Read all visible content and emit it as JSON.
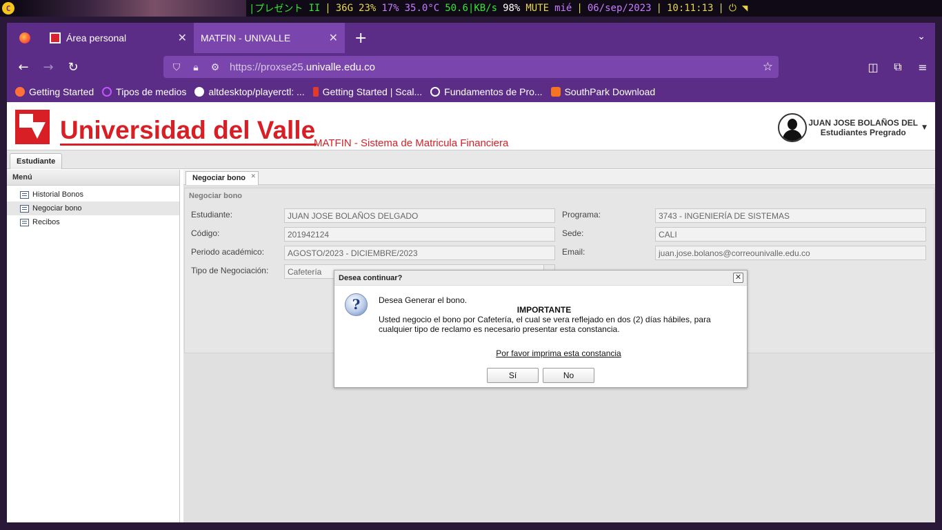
{
  "statusbar": {
    "segments": [
      "|プレゼント",
      "II",
      "|",
      "36G",
      "23%",
      "17%",
      "35.0°C",
      "50.6|KB/s",
      "98%",
      "MUTE",
      "mié",
      "|",
      "06/sep/2023",
      "|",
      "10:11:13",
      "|"
    ]
  },
  "browser": {
    "tabs": [
      {
        "label": "Área personal"
      },
      {
        "label": "MATFIN - UNIVALLE"
      }
    ],
    "url_proto": "https://proxse25.",
    "url_domain": "univalle.edu.co",
    "bookmarks": [
      {
        "label": "Getting Started",
        "color": "#ff7139"
      },
      {
        "label": "Tipos de medios",
        "color": "#c255ff"
      },
      {
        "label": "altdesktop/playerctl: ...",
        "color": "#ffffff"
      },
      {
        "label": "Getting Started | Scal...",
        "color": "#e23b2e"
      },
      {
        "label": "Fundamentos de Pro...",
        "color": "#ffffff"
      },
      {
        "label": "SouthPark Download",
        "color": "#f47421"
      }
    ]
  },
  "header": {
    "title": "Universidad del Valle",
    "subtitle": "MATFIN - Sistema de Matricula Financiera",
    "user_name": "JUAN JOSE BOLAÑOS DEL",
    "user_role": "Estudiantes Pregrado"
  },
  "top_tab": "Estudiante",
  "menu": {
    "title": "Menú",
    "items": [
      "Historial Bonos",
      "Negociar bono",
      "Recibos"
    ]
  },
  "content": {
    "tab": "Negociar bono",
    "panel_title": "Negociar bono",
    "fields": {
      "estudiante_label": "Estudiante:",
      "estudiante": "JUAN JOSE BOLAÑOS DELGADO",
      "codigo_label": "Código:",
      "codigo": "201942124",
      "periodo_label": "Periodo académico:",
      "periodo": "AGOSTO/2023 - DICIEMBRE/2023",
      "tipo_label": "Tipo de Negociación:",
      "tipo": "Cafetería",
      "programa_label": "Programa:",
      "programa": "3743 - INGENIERÍA DE SISTEMAS",
      "sede_label": "Sede:",
      "sede": "CALI",
      "email_label": "Email:",
      "email": "juan.jose.bolanos@correounivalle.edu.co"
    }
  },
  "dialog": {
    "title": "Desea continuar?",
    "line1": "Desea Generar el bono.",
    "important": "IMPORTANTE",
    "message": "Usted negocio el bono por Cafetería, el cual se vera reflejado en dos (2) días hábiles, para cualquier tipo de reclamo es necesario presentar esta constancia.",
    "link": "Por favor imprima esta constancia",
    "yes": "Sí",
    "no": "No"
  }
}
